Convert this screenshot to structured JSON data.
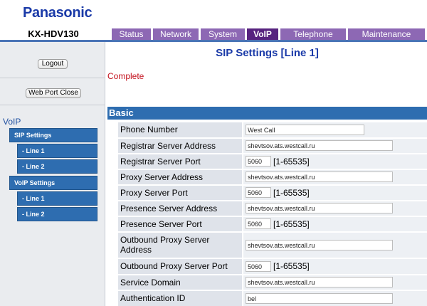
{
  "brand": {
    "logo": "Panasonic",
    "model": "KX-HDV130"
  },
  "tabs": [
    {
      "label": "Status"
    },
    {
      "label": "Network"
    },
    {
      "label": "System"
    },
    {
      "label": "VoIP"
    },
    {
      "label": "Telephone"
    },
    {
      "label": "Maintenance"
    }
  ],
  "sidebar": {
    "logout": "Logout",
    "web_port_close": "Web Port Close",
    "section": "VoIP",
    "items": [
      {
        "label": "SIP Settings"
      },
      {
        "label": "- Line 1"
      },
      {
        "label": "- Line 2"
      },
      {
        "label": "VoIP Settings"
      },
      {
        "label": "- Line 1"
      },
      {
        "label": "- Line 2"
      }
    ]
  },
  "main": {
    "title": "SIP Settings [Line 1]",
    "status": "Complete",
    "section": "Basic",
    "fields": [
      {
        "label": "Phone Number",
        "value": "West Call",
        "range": ""
      },
      {
        "label": "Registrar Server Address",
        "value": "shevtsov.ats.westcall.ru",
        "range": ""
      },
      {
        "label": "Registrar Server Port",
        "value": "5060",
        "range": "[1-65535]"
      },
      {
        "label": "Proxy Server Address",
        "value": "shevtsov.ats.westcall.ru",
        "range": ""
      },
      {
        "label": "Proxy Server Port",
        "value": "5060",
        "range": "[1-65535]"
      },
      {
        "label": "Presence Server Address",
        "value": "shevtsov.ats.westcall.ru",
        "range": ""
      },
      {
        "label": "Presence Server Port",
        "value": "5060",
        "range": "[1-65535]"
      },
      {
        "label": "Outbound Proxy Server Address",
        "value": "shevtsov.ats.westcall.ru",
        "range": ""
      },
      {
        "label": "Outbound Proxy Server Port",
        "value": "5060",
        "range": "[1-65535]"
      },
      {
        "label": "Service Domain",
        "value": "shevtsov.ats.westcall.ru",
        "range": ""
      },
      {
        "label": "Authentication ID",
        "value": "bel",
        "range": ""
      }
    ]
  }
}
